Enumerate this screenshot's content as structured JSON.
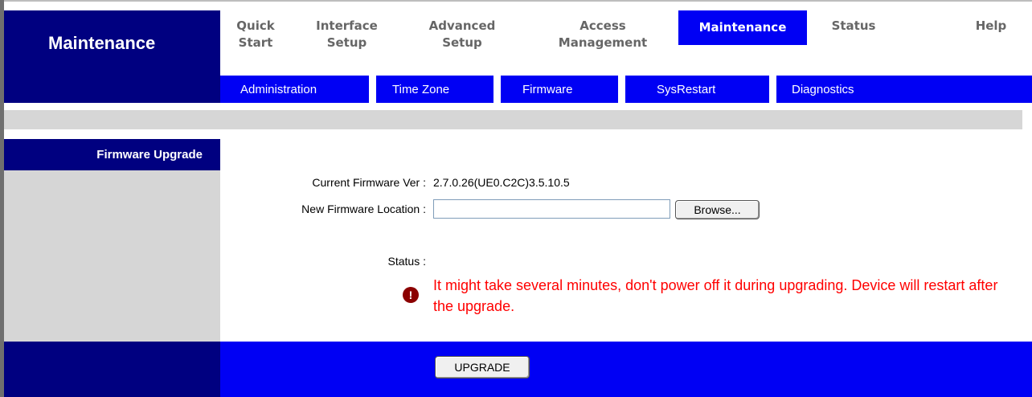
{
  "header": {
    "section_title": "Maintenance"
  },
  "nav": {
    "tabs": [
      {
        "label": "Quick\nStart"
      },
      {
        "label": "Interface\nSetup"
      },
      {
        "label": "Advanced\nSetup"
      },
      {
        "label": "Access\nManagement"
      },
      {
        "label": "Maintenance",
        "active": true
      },
      {
        "label": "Status"
      },
      {
        "label": "Help"
      }
    ]
  },
  "subnav": {
    "items": [
      "Administration",
      "Time Zone",
      "Firmware",
      "SysRestart",
      "Diagnostics"
    ]
  },
  "panel": {
    "title": "Firmware Upgrade",
    "current_fw_label": "Current Firmware Ver :",
    "current_fw_value": "2.7.0.26(UE0.C2C)3.5.10.5",
    "new_fw_label": "New Firmware Location :",
    "new_fw_value": "",
    "browse_label": "Browse...",
    "status_label": "Status :",
    "warning": "It might take several minutes, don't power off it during upgrading. Device will restart after the upgrade.",
    "upgrade_label": "UPGRADE"
  },
  "colors": {
    "dark_blue": "#000080",
    "bright_blue": "#0000f4",
    "grey": "#d6d6d6",
    "warning_red": "#ff0000"
  },
  "icons": {
    "warning": "exclamation-circle-icon"
  }
}
